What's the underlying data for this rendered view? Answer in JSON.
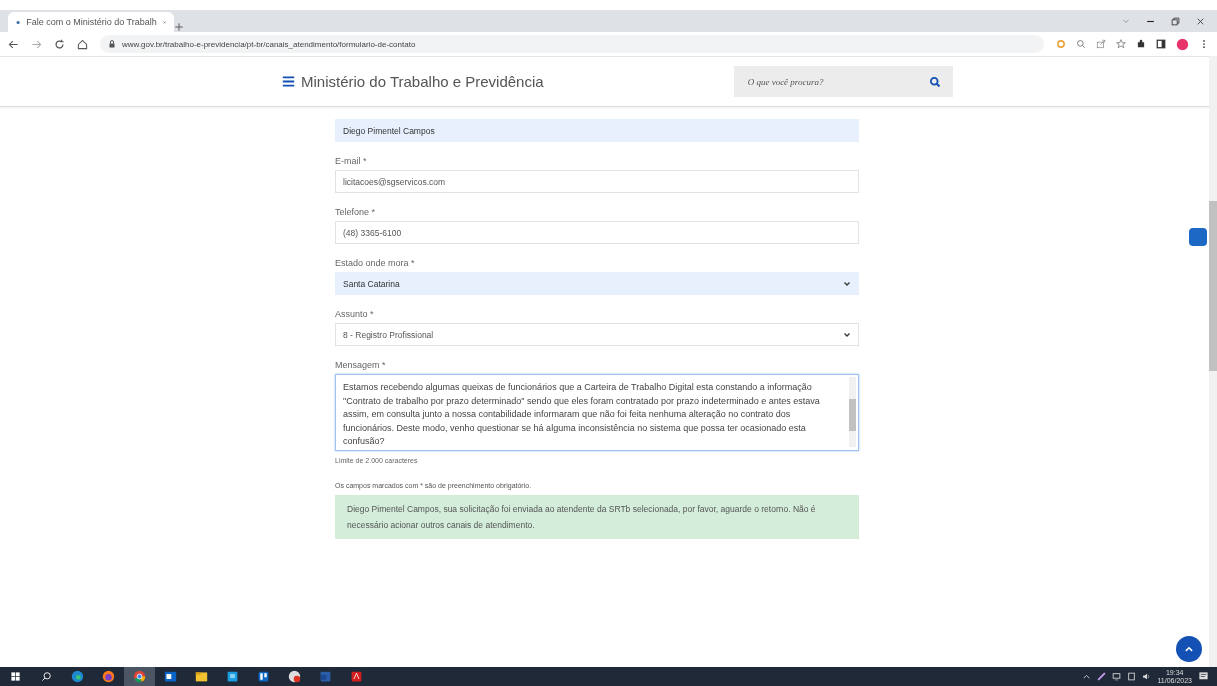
{
  "browser": {
    "tab_title": "Fale com o Ministério do Trabalh",
    "url": "www.gov.br/trabalho-e-previdencia/pt-br/canais_atendimento/formulario-de-contato"
  },
  "header": {
    "title": "Ministério do Trabalho e Previdência",
    "search": {
      "placeholder": "O que você procura?"
    }
  },
  "form": {
    "fields": [
      {
        "kind": "input",
        "value": "Diego Pimentel Campos",
        "autofilled": true,
        "focused": false
      },
      {
        "kind": "input",
        "label": "E-mail *",
        "value": "licitacoes@sgservicos.com",
        "autofilled": false,
        "focused": false
      },
      {
        "kind": "input",
        "label": "Telefone *",
        "value": "(48) 3365-6100",
        "autofilled": false,
        "focused": false
      },
      {
        "kind": "select",
        "label": "Estado onde mora *",
        "value": "Santa Catarina",
        "autofilled": true,
        "focused": false
      },
      {
        "kind": "select",
        "label": "Assunto *",
        "value": "8 - Registro Profissional",
        "autofilled": false,
        "focused": false
      },
      {
        "kind": "textarea",
        "label": "Mensagem *",
        "value": "Estamos recebendo algumas queixas de funcionários que a Carteira de Trabalho Digital esta constando a informação \"Contrato de trabalho por prazo determinado\" sendo que eles foram contratado por prazo indeterminado e antes estava assim, em consulta junto a nossa contabilidade informaram que não foi feita nenhuma alteração no contrato dos funcionários. Deste modo, venho questionar se há alguma inconsistência no sistema que possa ter ocasionado esta confusão?",
        "autofilled": false,
        "focused": true
      }
    ],
    "limit_hint": "Limite de 2.000 caracteres",
    "required_note": "Os campos marcados com * são de preenchimento obrigatório.",
    "success_message": "Diego Pimentel Campos, sua solicitação foi enviada ao atendente da SRTb selecionada, por favor, aguarde o retorno. Não é necessário acionar outros canais de atendimento."
  },
  "taskbar": {
    "apps": [
      {
        "kind": "browser-edge",
        "selected": false
      },
      {
        "kind": "browser-firefox",
        "selected": false
      },
      {
        "kind": "browser-chrome",
        "selected": true
      },
      {
        "kind": "mail",
        "selected": false
      },
      {
        "kind": "folder",
        "selected": false
      },
      {
        "kind": "store",
        "selected": false
      },
      {
        "kind": "board",
        "selected": false
      },
      {
        "kind": "shield",
        "selected": false
      },
      {
        "kind": "word",
        "selected": false
      },
      {
        "kind": "pdf",
        "selected": false
      }
    ],
    "time": "19:34",
    "date": "11/06/2023"
  }
}
